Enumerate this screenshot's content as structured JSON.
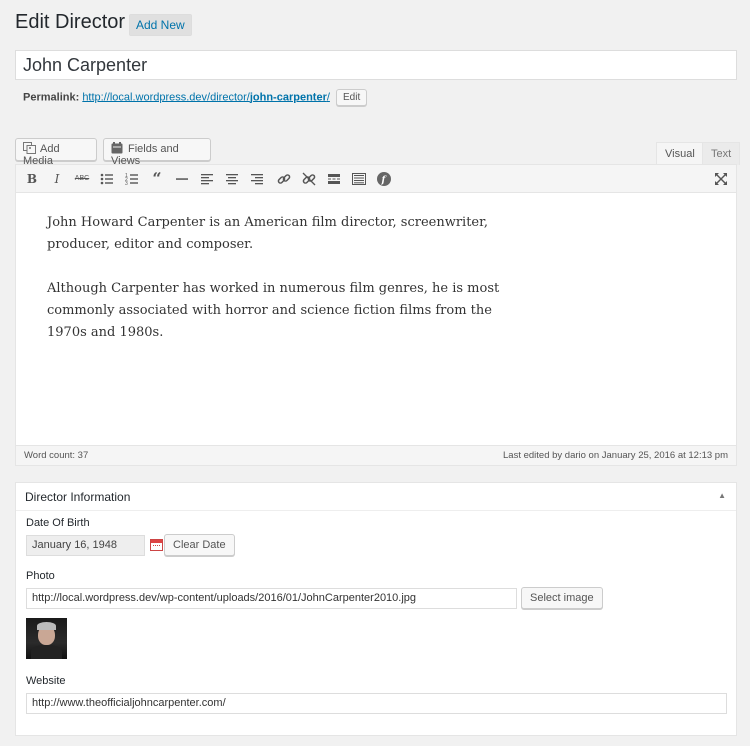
{
  "header": {
    "title": "Edit Director",
    "add_new": "Add New"
  },
  "post": {
    "title": "John Carpenter",
    "permalink_label": "Permalink:",
    "permalink_base": "http://local.wordpress.dev/director/",
    "permalink_slug": "john-carpenter",
    "permalink_trailing": "/",
    "permalink_edit": "Edit"
  },
  "media_buttons": {
    "add_media": "Add Media",
    "fields_and_views": "Fields and Views"
  },
  "editor_tabs": {
    "visual": "Visual",
    "text": "Text"
  },
  "toolbar_icons": [
    "bold-icon",
    "italic-icon",
    "strikethrough-icon",
    "bulleted-list-icon",
    "numbered-list-icon",
    "blockquote-icon",
    "horizontal-rule-icon",
    "align-left-icon",
    "align-center-icon",
    "align-right-icon",
    "insert-link-icon",
    "remove-link-icon",
    "read-more-icon",
    "toolbar-toggle-icon",
    "types-fields-icon",
    "fullscreen-icon"
  ],
  "content": {
    "para1": "John Howard Carpenter is an American film director, screenwriter, producer, editor and composer.",
    "para2": "Although Carpenter has worked in numerous film genres, he is most commonly associated with horror and science fiction films from the 1970s and 1980s."
  },
  "status": {
    "word_count": "Word count: 37",
    "last_edited": "Last edited by dario on January 25, 2016 at 12:13 pm"
  },
  "director_info": {
    "title": "Director Information",
    "dob_label": "Date Of Birth",
    "dob_value": "January 16, 1948",
    "clear_date": "Clear Date",
    "photo_label": "Photo",
    "photo_value": "http://local.wordpress.dev/wp-content/uploads/2016/01/JohnCarpenter2010.jpg",
    "select_image": "Select image",
    "website_label": "Website",
    "website_value": "http://www.theofficialjohncarpenter.com/"
  }
}
